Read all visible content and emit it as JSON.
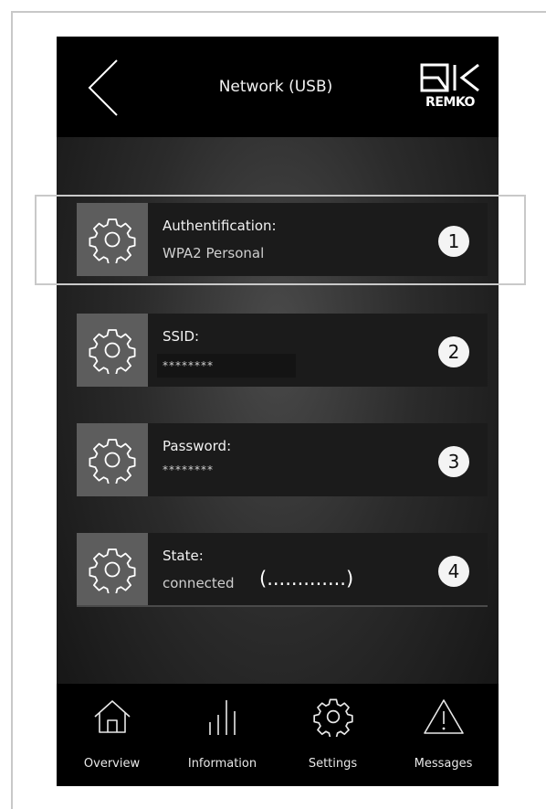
{
  "header": {
    "title": "Network (USB)",
    "back_icon": "chevron-left-icon",
    "logo_text": "REMKO"
  },
  "rows": [
    {
      "label": "Authentification:",
      "value": "WPA2 Personal",
      "number": "1",
      "icon": "gear-icon"
    },
    {
      "label": "SSID:",
      "value": "********",
      "number": "2",
      "icon": "gear-icon"
    },
    {
      "label": "Password:",
      "value": "********",
      "number": "3",
      "icon": "gear-icon"
    },
    {
      "label": "State:",
      "value": "connected",
      "extra": "(.............)",
      "number": "4",
      "icon": "gear-icon"
    }
  ],
  "nav": [
    {
      "label": "Overview",
      "icon": "home-icon"
    },
    {
      "label": "Information",
      "icon": "bar-chart-icon"
    },
    {
      "label": "Settings",
      "icon": "gear-icon"
    },
    {
      "label": "Messages",
      "icon": "warning-icon"
    }
  ],
  "colors": {
    "header_bg": "#000000",
    "row_bg": "#1b1b1b",
    "gear_box_bg": "#5d5d5d",
    "badge_bg": "#f4f4f4",
    "highlight_border": "#c9c9c9"
  }
}
